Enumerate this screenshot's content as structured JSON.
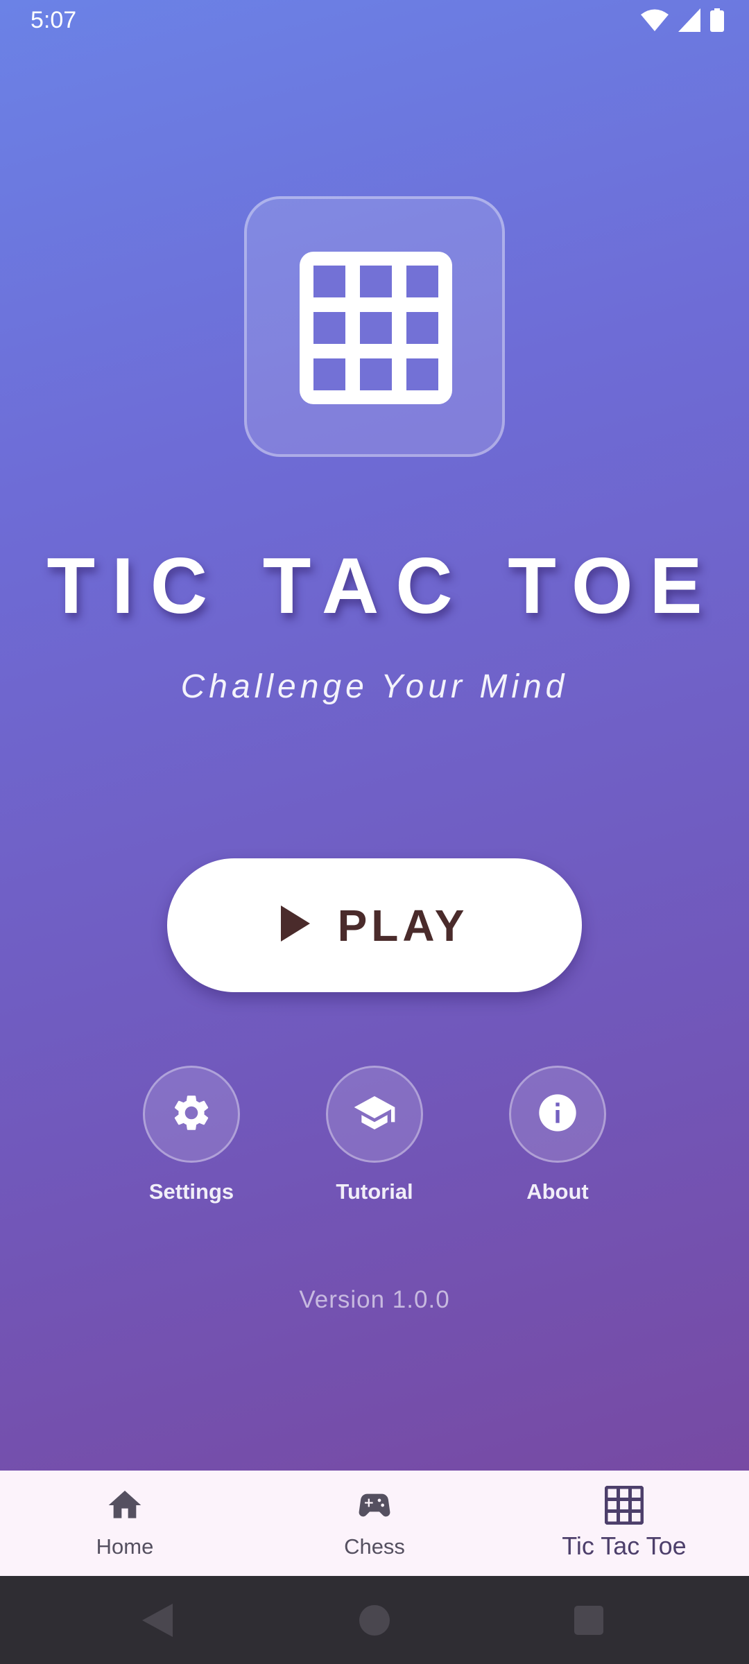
{
  "status_bar": {
    "time": "5:07",
    "icons": [
      "wifi-icon",
      "cellular-signal-icon",
      "battery-icon"
    ]
  },
  "logo": {
    "icon": "grid-icon"
  },
  "header": {
    "title": "TIC TAC TOE",
    "subtitle": "Challenge Your Mind"
  },
  "play_button": {
    "label": "PLAY",
    "icon": "play-icon"
  },
  "actions": [
    {
      "label": "Settings",
      "icon": "gear-icon"
    },
    {
      "label": "Tutorial",
      "icon": "graduation-cap-icon"
    },
    {
      "label": "About",
      "icon": "info-icon"
    }
  ],
  "version": "Version 1.0.0",
  "bottom_nav": {
    "items": [
      {
        "label": "Home",
        "icon": "home-icon",
        "active": false
      },
      {
        "label": "Chess",
        "icon": "gamepad-icon",
        "active": false
      },
      {
        "label": "Tic Tac Toe",
        "icon": "grid-icon",
        "active": true
      }
    ]
  },
  "system_nav": [
    "back-button",
    "home-button",
    "recents-button"
  ],
  "colors": {
    "gradient_top": "#6b82e6",
    "gradient_bottom": "#774aa3",
    "play_text": "#4a2b2b",
    "nav_background": "#fcf3fb",
    "nav_active": "#4d3f6b",
    "system_nav_background": "#2f2d33"
  }
}
